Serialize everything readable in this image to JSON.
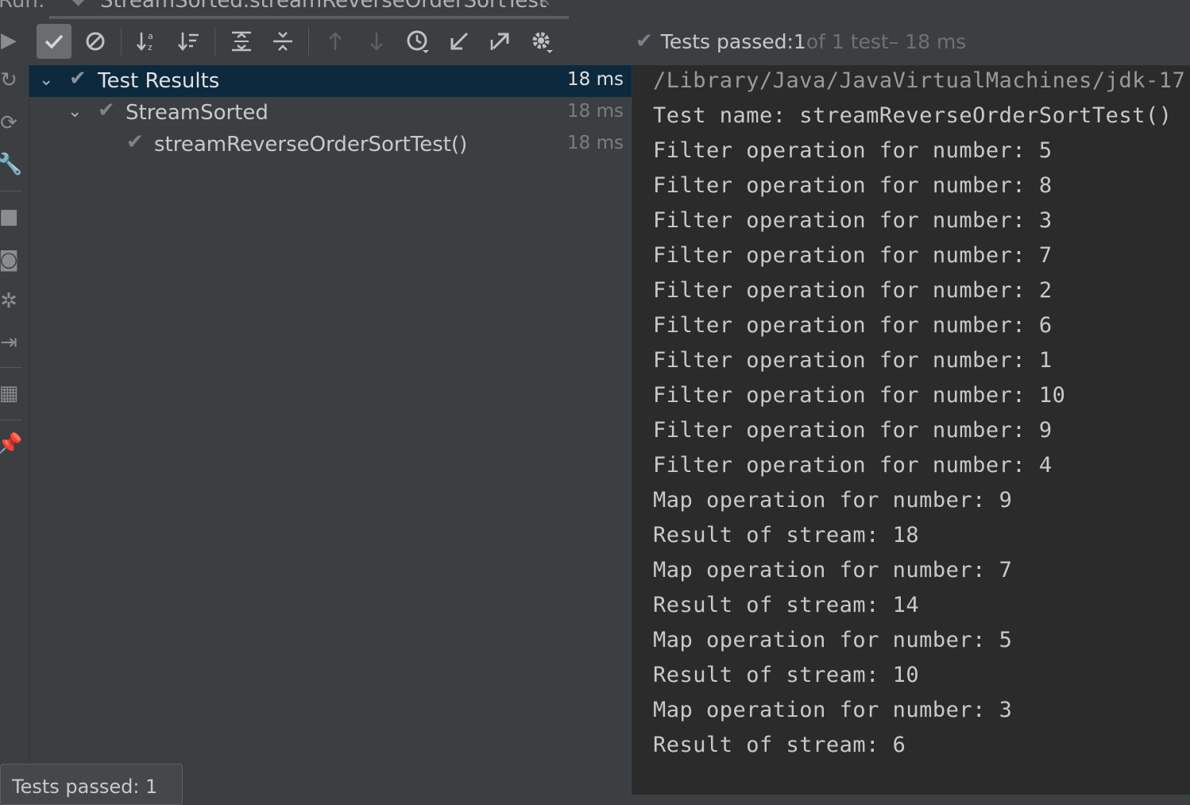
{
  "run_bar": {
    "label": "Run:",
    "tab_title": "StreamSorted.streamReverseOrderSortTest",
    "tab_close": "×"
  },
  "toolbar": {
    "buttons": [
      {
        "name": "show-passed",
        "icon": "check-icon",
        "active": true
      },
      {
        "name": "show-ignored",
        "icon": "ignored-icon"
      },
      {
        "name": "sort-alphabetically",
        "icon": "sort-alpha-icon"
      },
      {
        "name": "sort-by-duration",
        "icon": "sort-duration-icon"
      },
      {
        "name": "expand-all",
        "icon": "expand-all-icon"
      },
      {
        "name": "collapse-all",
        "icon": "collapse-all-icon"
      },
      {
        "name": "previous-failed",
        "icon": "arrow-up-icon",
        "disabled": true
      },
      {
        "name": "next-failed",
        "icon": "arrow-down-icon",
        "disabled": true
      },
      {
        "name": "test-history",
        "icon": "history-icon"
      },
      {
        "name": "import-tests",
        "icon": "import-icon"
      },
      {
        "name": "export-results",
        "icon": "export-icon"
      },
      {
        "name": "settings",
        "icon": "gear-icon"
      }
    ]
  },
  "status": {
    "label": "Tests passed: ",
    "passed": "1",
    "of_total": " of 1 test",
    "duration": " – 18 ms"
  },
  "tree": {
    "rows": [
      {
        "name": "Test Results",
        "time": "18 ms",
        "selected": true
      },
      {
        "name": "StreamSorted",
        "time": "18 ms"
      },
      {
        "name": "streamReverseOrderSortTest()",
        "time": "18 ms"
      }
    ]
  },
  "console": {
    "lines": [
      "/Library/Java/JavaVirtualMachines/jdk-17",
      "Test name: streamReverseOrderSortTest()",
      "Filter operation for number: 5",
      "Filter operation for number: 8",
      "Filter operation for number: 3",
      "Filter operation for number: 7",
      "Filter operation for number: 2",
      "Filter operation for number: 6",
      "Filter operation for number: 1",
      "Filter operation for number: 10",
      "Filter operation for number: 9",
      "Filter operation for number: 4",
      "Map operation for number: 9",
      "Result of stream: 18",
      "Map operation for number: 7",
      "Result of stream: 14",
      "Map operation for number: 5",
      "Result of stream: 10",
      "Map operation for number: 3",
      "Result of stream: 6"
    ]
  },
  "footer": {
    "tooltip": "Tests passed: 1"
  },
  "colors": {
    "panel": "#3c3f41",
    "console_bg": "#2b2b2b",
    "selection": "#0d293e",
    "text": "#c9c9c9"
  }
}
